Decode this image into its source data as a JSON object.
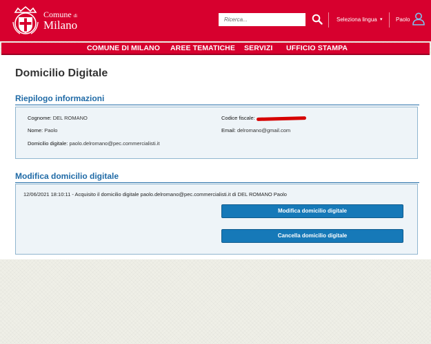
{
  "header": {
    "logo_line1": "Comune",
    "logo_line1_small": "di",
    "logo_line2": "Milano",
    "search_placeholder": "Ricerca...",
    "language_label": "Seleziona lingua",
    "language_caret": "▾",
    "user_name": "Paolo",
    "brand_color": "#d7002e"
  },
  "nav": {
    "items": [
      "COMUNE DI MILANO",
      "AREE TEMATICHE",
      "SERVIZI",
      "UFFICIO STAMPA"
    ]
  },
  "page": {
    "title": "Domicilio Digitale"
  },
  "summary": {
    "title": "Riepilogo informazioni",
    "surname_label": "Cognome:",
    "surname_value": "DEL ROMANO",
    "name_label": "Nome:",
    "name_value": "Paolo",
    "domicile_label": "Domicilio digitale:",
    "domicile_value": "paolo.delromano@pec.commercialisti.it",
    "tax_code_label": "Codice fiscale:",
    "email_label": "Email:",
    "email_value": "delromano@gmail.com"
  },
  "modify": {
    "title": "Modifica domicilio digitale",
    "log_entry": "12/06/2021 18:10:11 - Acquisito il domicilio digitale paolo.delromano@pec.commercialisti.it di DEL ROMANO Paolo",
    "modify_button": "Modifica domicilio digitale",
    "cancel_button": "Cancella domicilio digitale",
    "button_color": "#1679b8"
  }
}
